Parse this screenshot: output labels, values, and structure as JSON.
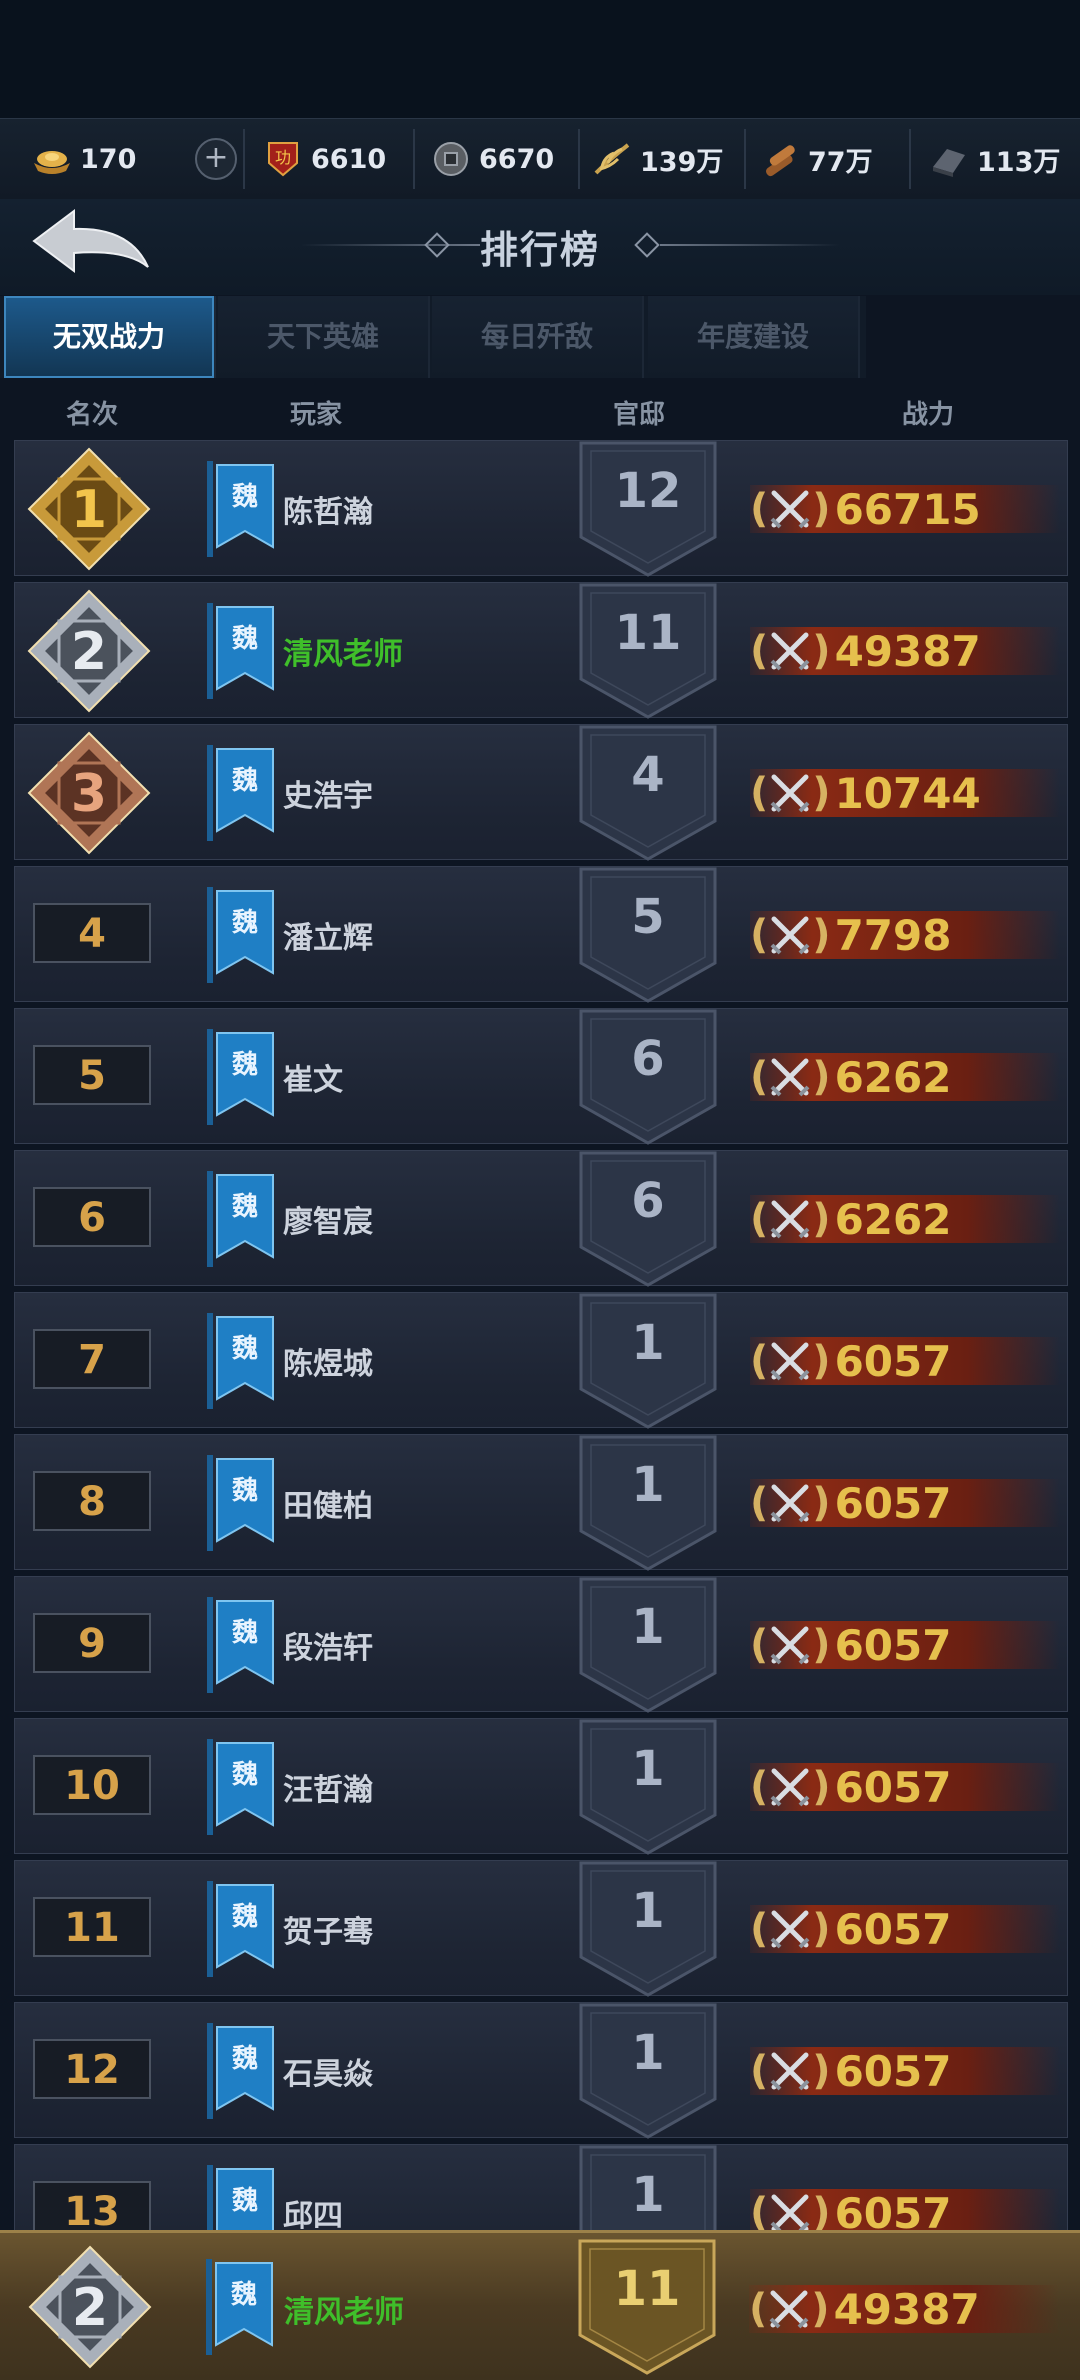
{
  "resources": [
    {
      "icon": "gold-ingot-icon",
      "value": "170"
    },
    {
      "icon": "merit-badge-icon",
      "value": "6610"
    },
    {
      "icon": "copper-coin-icon",
      "value": "6670"
    },
    {
      "icon": "grain-icon",
      "value": "139万"
    },
    {
      "icon": "wood-icon",
      "value": "77万"
    },
    {
      "icon": "iron-icon",
      "value": "113万"
    }
  ],
  "header": {
    "title": "排行榜"
  },
  "tabs": [
    {
      "label": "无双战力",
      "active": true
    },
    {
      "label": "天下英雄",
      "active": false
    },
    {
      "label": "每日歼敌",
      "active": false
    },
    {
      "label": "年度建设",
      "active": false
    }
  ],
  "columns": {
    "rank": "名次",
    "player": "玩家",
    "mansion": "官邸",
    "power": "战力"
  },
  "rows": [
    {
      "rank": "1",
      "faction": "魏",
      "name": "陈哲瀚",
      "mansion": "12",
      "power": "66715"
    },
    {
      "rank": "2",
      "faction": "魏",
      "name": "清风老师",
      "mansion": "11",
      "power": "49387"
    },
    {
      "rank": "3",
      "faction": "魏",
      "name": "史浩宇",
      "mansion": "4",
      "power": "10744"
    },
    {
      "rank": "4",
      "faction": "魏",
      "name": "潘立辉",
      "mansion": "5",
      "power": "7798"
    },
    {
      "rank": "5",
      "faction": "魏",
      "name": "崔文",
      "mansion": "6",
      "power": "6262"
    },
    {
      "rank": "6",
      "faction": "魏",
      "name": "廖智宸",
      "mansion": "6",
      "power": "6262"
    },
    {
      "rank": "7",
      "faction": "魏",
      "name": "陈煜城",
      "mansion": "1",
      "power": "6057"
    },
    {
      "rank": "8",
      "faction": "魏",
      "name": "田健柏",
      "mansion": "1",
      "power": "6057"
    },
    {
      "rank": "9",
      "faction": "魏",
      "name": "段浩轩",
      "mansion": "1",
      "power": "6057"
    },
    {
      "rank": "10",
      "faction": "魏",
      "name": "汪哲瀚",
      "mansion": "1",
      "power": "6057"
    },
    {
      "rank": "11",
      "faction": "魏",
      "name": "贺子骞",
      "mansion": "1",
      "power": "6057"
    },
    {
      "rank": "12",
      "faction": "魏",
      "name": "石昊焱",
      "mansion": "1",
      "power": "6057"
    },
    {
      "rank": "13",
      "faction": "魏",
      "name": "邱四",
      "mansion": "1",
      "power": "6057"
    }
  ],
  "self": {
    "rank": "2",
    "faction": "魏",
    "name": "清风老师",
    "mansion": "11",
    "power": "49387"
  }
}
